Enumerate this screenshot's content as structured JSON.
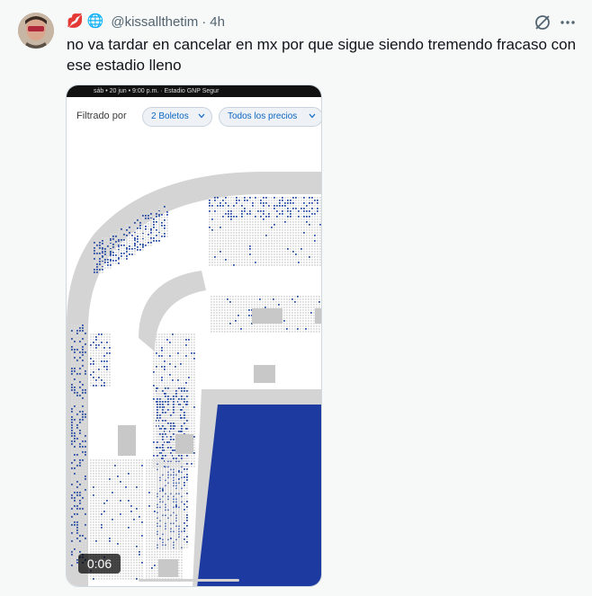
{
  "tweet": {
    "emoji_1": "💋",
    "emoji_2": "🌐",
    "handle": "@kissallthetim",
    "separator": "·",
    "time": "4h",
    "text": "no va tardar en cancelar en mx por que sigue siendo tremendo fracaso con ese estadio lleno"
  },
  "video": {
    "status_text": "sáb • 20 jun • 9:00 p.m. · Estadio GNP Segur",
    "filter_label": "Filtrado por",
    "pill_tickets": "2 Boletos",
    "pill_prices": "Todos los precios",
    "duration": "0:06"
  },
  "colors": {
    "accent": "#0a66c2",
    "field": "#1d3aa0",
    "concourse": "#d4d4d4",
    "seat_sold": "#dcdcdc",
    "seat_available": "#2c4fa6"
  }
}
